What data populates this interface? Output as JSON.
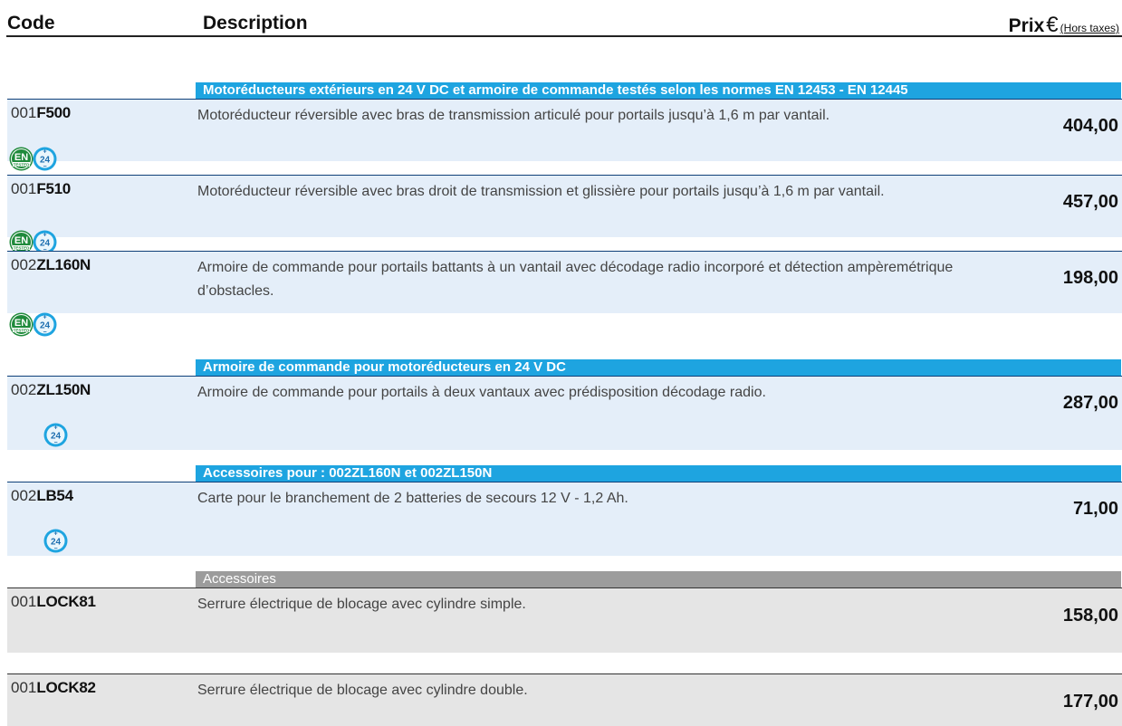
{
  "header": {
    "code": "Code",
    "description": "Description",
    "prix": "Prix",
    "currency": "€",
    "hors_taxes": "(Hors taxes)"
  },
  "sections": {
    "s1": "Motoréducteurs extérieurs en 24 V DC et armoire de commande testés selon les normes EN 12453 - EN 12445",
    "s2": "Armoire de commande pour motoréducteurs en 24 V DC",
    "s3": "Accessoires pour : 002ZL160N et 002ZL150N",
    "s4": "Accessoires"
  },
  "items": [
    {
      "prefix": "001",
      "code": "F500",
      "desc": "Motoréducteur réversible avec bras de transmission articulé pour portails jusqu’à 1,6 m par vantail.",
      "price": "404,00",
      "icons": [
        "EN TESTED",
        "24"
      ]
    },
    {
      "prefix": "001",
      "code": "F510",
      "desc": "Motoréducteur réversible avec bras droit de transmission et glissière pour portails jusqu’à 1,6 m par vantail.",
      "price": "457,00",
      "icons": [
        "EN TESTED",
        "24"
      ]
    },
    {
      "prefix": "002",
      "code": "ZL160N",
      "desc": "Armoire de commande pour portails battants à un vantail avec décodage radio incorporé et détection ampèremétrique d’obstacles.",
      "price": "198,00",
      "icons": [
        "EN TESTED",
        "24"
      ]
    },
    {
      "prefix": "002",
      "code": "ZL150N",
      "desc": "Armoire de commande pour portails à deux vantaux avec prédisposition décodage radio.",
      "price": "287,00",
      "icons": [
        "24"
      ]
    },
    {
      "prefix": "002",
      "code": "LB54",
      "desc": "Carte pour le branchement de 2 batteries de secours 12 V - 1,2 Ah.",
      "price": "71,00",
      "icons": [
        "24"
      ]
    },
    {
      "prefix": "001",
      "code": "LOCK81",
      "desc": "Serrure électrique de blocage avec cylindre simple.",
      "price": "158,00",
      "icons": []
    },
    {
      "prefix": "001",
      "code": "LOCK82",
      "desc": "Serrure électrique de blocage avec cylindre double.",
      "price": "177,00",
      "icons": []
    }
  ],
  "icon_names": {
    "en": "en-tested-badge-icon",
    "v24": "24v-badge-icon"
  },
  "colors": {
    "blue_band": "#1ea4e0",
    "grey_band": "#9c9c9c",
    "row_blue": "#e4eef9",
    "row_grey": "#e5e5e5",
    "en_green": "#1f8a3b"
  }
}
